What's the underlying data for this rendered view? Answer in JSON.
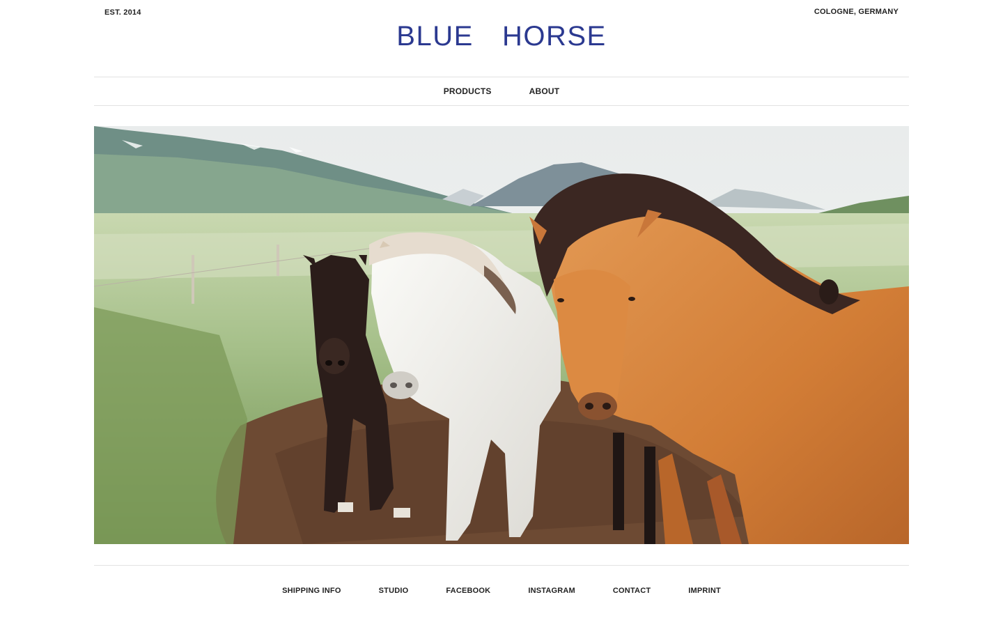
{
  "header": {
    "established": "EST. 2014",
    "location": "COLOGNE, GERMANY",
    "logo": "BLUE  HORSE"
  },
  "nav": {
    "items": [
      {
        "label": "PRODUCTS"
      },
      {
        "label": "ABOUT"
      }
    ]
  },
  "hero": {
    "image_icon": "horses-photo"
  },
  "footer": {
    "items": [
      {
        "label": "SHIPPING INFO"
      },
      {
        "label": "STUDIO"
      },
      {
        "label": "FACEBOOK"
      },
      {
        "label": "INSTAGRAM"
      },
      {
        "label": "CONTACT"
      },
      {
        "label": "IMPRINT"
      }
    ]
  },
  "colors": {
    "brand": "#2b3990",
    "text": "#222222",
    "divider": "#e2e2e2"
  }
}
